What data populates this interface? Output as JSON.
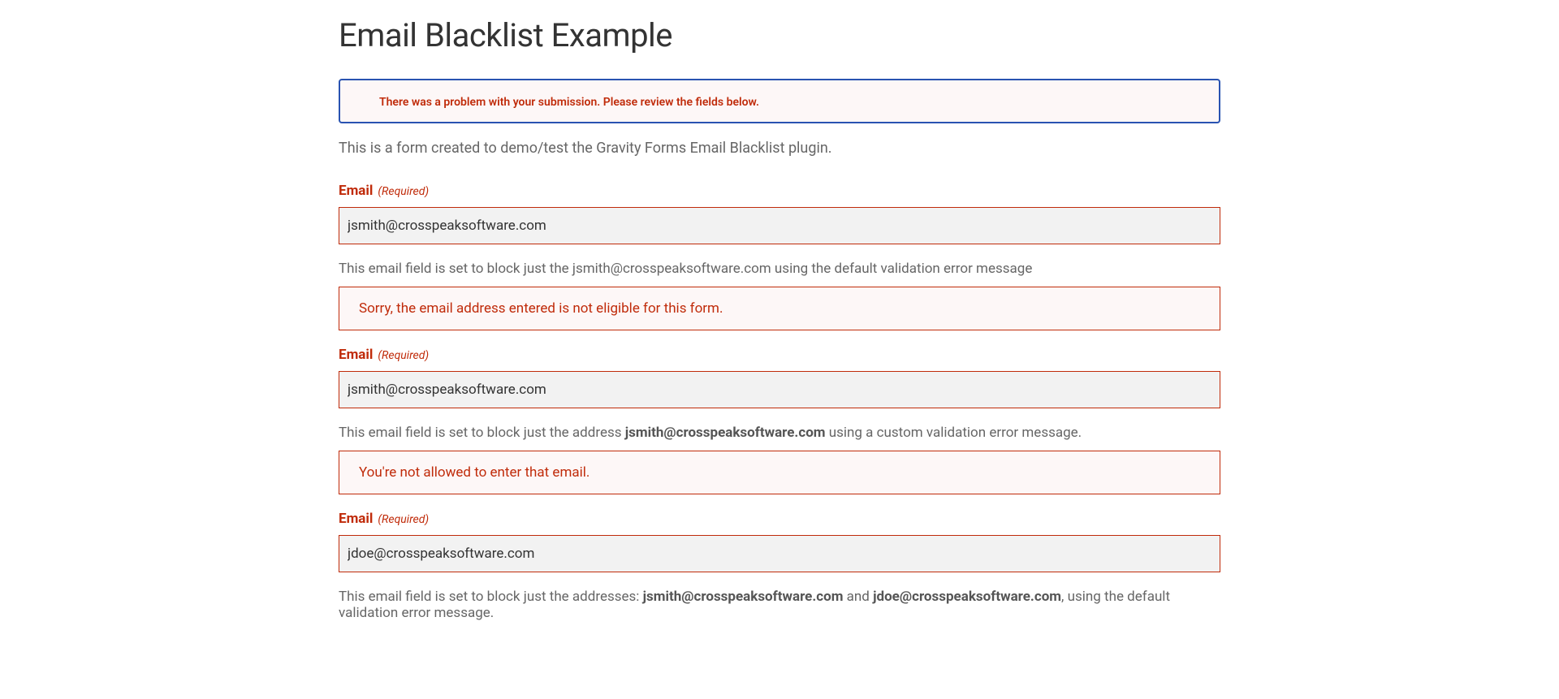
{
  "page_title": "Email Blacklist Example",
  "validation_error": "There was a problem with your submission. Please review the fields below.",
  "intro": "This is a form created to demo/test the Gravity Forms Email Blacklist plugin.",
  "required_label": "(Required)",
  "fields": [
    {
      "label": "Email",
      "value": "jsmith@crosspeaksoftware.com",
      "description_pre": "This email field is set to block just the jsmith@crosspeaksoftware.com using the default validation error message",
      "description_bold": "",
      "description_post": "",
      "error": "Sorry, the email address entered is not eligible for this form."
    },
    {
      "label": "Email",
      "value": "jsmith@crosspeaksoftware.com",
      "description_pre": "This email field is set to block just the address ",
      "description_bold": "jsmith@crosspeaksoftware.com",
      "description_post": " using a custom validation error message.",
      "error": "You're not allowed to enter that email."
    },
    {
      "label": "Email",
      "value": "jdoe@crosspeaksoftware.com",
      "description_pre": "This email field is set to block just the addresses: ",
      "description_bold": "jsmith@crosspeaksoftware.com",
      "description_mid": " and ",
      "description_bold2": "jdoe@crosspeaksoftware.com",
      "description_post": ", using the default validation error message.",
      "error": ""
    }
  ]
}
